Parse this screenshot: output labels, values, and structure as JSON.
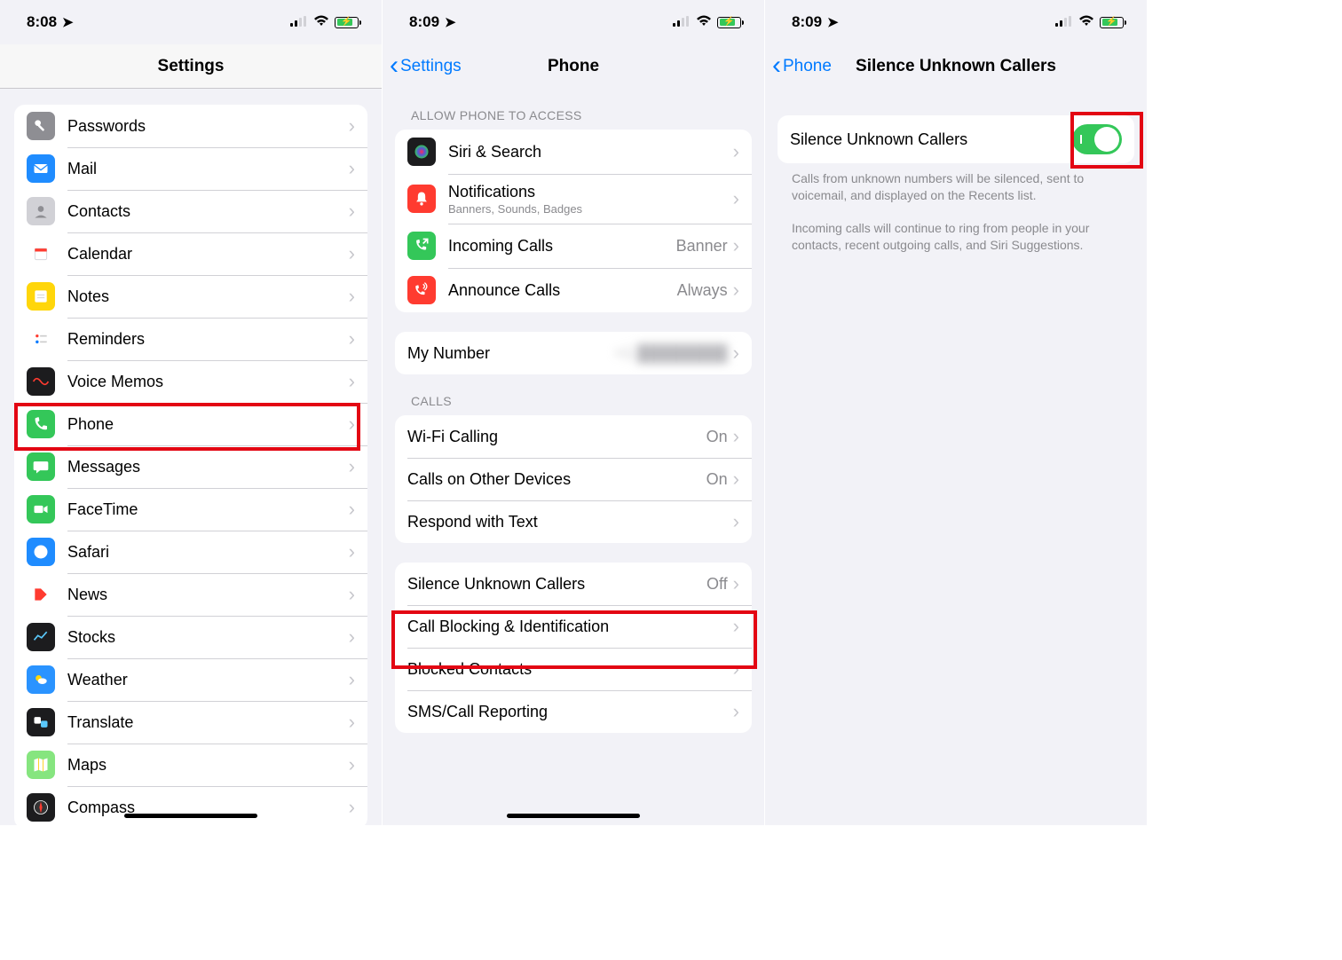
{
  "screen1": {
    "time": "8:08",
    "title": "Settings",
    "items": [
      {
        "label": "Passwords",
        "icon": "key",
        "bg": "#8e8e93"
      },
      {
        "label": "Mail",
        "icon": "mail",
        "bg": "#1f8cff"
      },
      {
        "label": "Contacts",
        "icon": "contacts",
        "bg": "#d1d1d6"
      },
      {
        "label": "Calendar",
        "icon": "calendar",
        "bg": "#ffffff"
      },
      {
        "label": "Notes",
        "icon": "notes",
        "bg": "#ffd60a"
      },
      {
        "label": "Reminders",
        "icon": "reminders",
        "bg": "#ffffff"
      },
      {
        "label": "Voice Memos",
        "icon": "voicememos",
        "bg": "#1c1c1e"
      },
      {
        "label": "Phone",
        "icon": "phone",
        "bg": "#34c759"
      },
      {
        "label": "Messages",
        "icon": "messages",
        "bg": "#34c759"
      },
      {
        "label": "FaceTime",
        "icon": "facetime",
        "bg": "#34c759"
      },
      {
        "label": "Safari",
        "icon": "safari",
        "bg": "#1f8cff"
      },
      {
        "label": "News",
        "icon": "news",
        "bg": "#ffffff"
      },
      {
        "label": "Stocks",
        "icon": "stocks",
        "bg": "#1c1c1e"
      },
      {
        "label": "Weather",
        "icon": "weather",
        "bg": "#2a93ff"
      },
      {
        "label": "Translate",
        "icon": "translate",
        "bg": "#1c1c1e"
      },
      {
        "label": "Maps",
        "icon": "maps",
        "bg": "#86e57f"
      },
      {
        "label": "Compass",
        "icon": "compass",
        "bg": "#1c1c1e"
      }
    ]
  },
  "screen2": {
    "time": "8:09",
    "back": "Settings",
    "title": "Phone",
    "section_allow_header": "ALLOW PHONE TO ACCESS",
    "allow": [
      {
        "label": "Siri & Search",
        "sub": "",
        "value": "",
        "icon": "siri",
        "bg": "#1c1c1e"
      },
      {
        "label": "Notifications",
        "sub": "Banners, Sounds, Badges",
        "value": "",
        "icon": "bell",
        "bg": "#ff3b30"
      },
      {
        "label": "Incoming Calls",
        "sub": "",
        "value": "Banner",
        "icon": "incoming",
        "bg": "#34c759"
      },
      {
        "label": "Announce Calls",
        "sub": "",
        "value": "Always",
        "icon": "announce",
        "bg": "#ff3b30"
      }
    ],
    "mynumber_label": "My Number",
    "mynumber_value": "+1",
    "section_calls_header": "CALLS",
    "calls": [
      {
        "label": "Wi-Fi Calling",
        "value": "On"
      },
      {
        "label": "Calls on Other Devices",
        "value": "On"
      },
      {
        "label": "Respond with Text",
        "value": ""
      }
    ],
    "block": [
      {
        "label": "Silence Unknown Callers",
        "value": "Off"
      },
      {
        "label": "Call Blocking & Identification",
        "value": ""
      },
      {
        "label": "Blocked Contacts",
        "value": ""
      },
      {
        "label": "SMS/Call Reporting",
        "value": ""
      }
    ]
  },
  "screen3": {
    "time": "8:09",
    "back": "Phone",
    "title": "Silence Unknown Callers",
    "toggle_label": "Silence Unknown Callers",
    "toggle_on": true,
    "desc1": "Calls from unknown numbers will be silenced, sent to voicemail, and displayed on the Recents list.",
    "desc2": "Incoming calls will continue to ring from people in your contacts, recent outgoing calls, and Siri Suggestions."
  }
}
